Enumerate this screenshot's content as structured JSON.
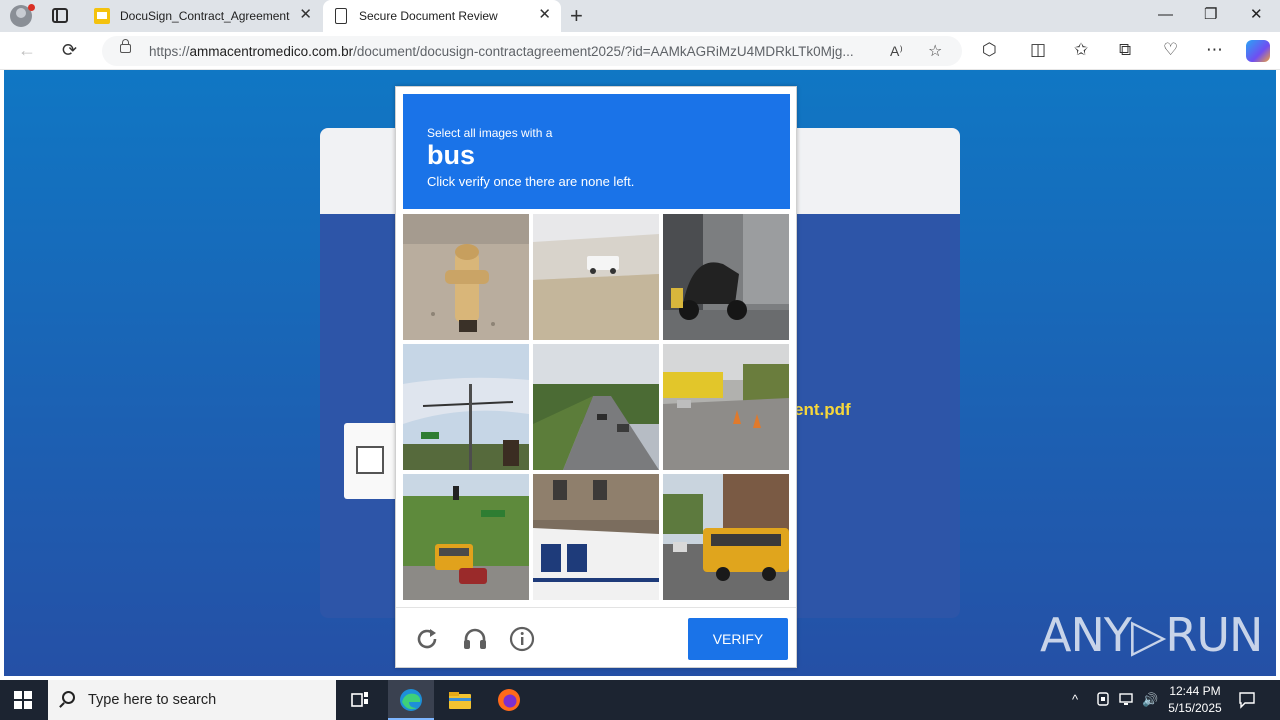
{
  "browser": {
    "tabs": [
      {
        "title": "DocuSign_Contract_Agreement",
        "active": false,
        "icon": "docusign-doc-icon"
      },
      {
        "title": "Secure Document Review",
        "active": true,
        "icon": "page-icon"
      }
    ],
    "close_glyph": "✕",
    "new_tab_glyph": "+",
    "window_controls": {
      "minimize": "—",
      "restore": "❐",
      "close": "✕"
    },
    "nav": {
      "back": "←",
      "refresh": "⟳"
    },
    "url": {
      "prefix": "https://",
      "domain": "ammacentromedico.com.br",
      "path": "/document/docusign-contractagreement2025/?id=AAMkAGRiMzU4MDRkLTk0Mjg..."
    },
    "toolbar_glyphs": {
      "read_aloud": "A⁾",
      "favorite": "☆",
      "extensions": "⬡",
      "split": "◫",
      "favorites": "✩",
      "collections": "⧉",
      "health": "♡",
      "more": "⋯"
    }
  },
  "page": {
    "filename_fragment": "ent.pdf",
    "colors": {
      "bg_top": "#1077c4",
      "bg_bottom": "#2550a6",
      "accent_yellow": "#f6d73b"
    }
  },
  "captcha": {
    "instruction": "Select all images with a",
    "target": "bus",
    "subtext": "Click verify once there are none left.",
    "verify_label": "VERIFY",
    "footer_icons": [
      "refresh-icon",
      "headphones-icon",
      "info-icon"
    ],
    "tiles": [
      {
        "subject": "fire hydrant"
      },
      {
        "subject": "road with white truck"
      },
      {
        "subject": "scooter"
      },
      {
        "subject": "traffic light"
      },
      {
        "subject": "highway with cars"
      },
      {
        "subject": "street with cones"
      },
      {
        "subject": "school bus at intersection"
      },
      {
        "subject": "white bus"
      },
      {
        "subject": "school bus on street"
      }
    ],
    "colors": {
      "header": "#1a73e8",
      "button": "#1a73e8"
    }
  },
  "watermark": {
    "text": "ANY▷RUN"
  },
  "taskbar": {
    "search_placeholder": "Type here to search",
    "apps": [
      "task-view-icon",
      "edge-icon",
      "file-explorer-icon",
      "firefox-icon"
    ],
    "tray": {
      "chevron": "^",
      "speaker": "🔊"
    },
    "clock": {
      "time": "12:44 PM",
      "date": "5/15/2025"
    }
  }
}
